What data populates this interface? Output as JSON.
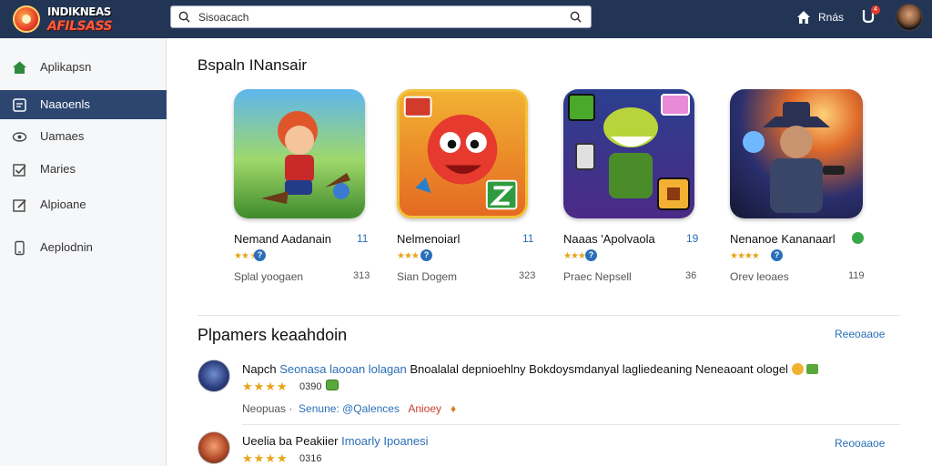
{
  "header": {
    "logo_line1": "INDIKNEAS",
    "logo_line2": "AFILSASS",
    "search_value": "Sisoacach",
    "home_label": "Rnás",
    "notif_count": "4"
  },
  "sidebar": {
    "items": [
      {
        "label": "Aplikapsn",
        "icon": "home-icon",
        "active": false
      },
      {
        "label": "Naaoenls",
        "icon": "list-icon",
        "active": true
      },
      {
        "label": "Uamaes",
        "icon": "eye-icon",
        "active": false
      },
      {
        "label": "Maries",
        "icon": "check-box-icon",
        "active": false
      },
      {
        "label": "Alpioane",
        "icon": "edit-icon",
        "active": false
      },
      {
        "label": "Aeplodnin",
        "icon": "phone-icon",
        "active": false
      }
    ]
  },
  "featured": {
    "title": "Bspaln INansair",
    "apps": [
      {
        "name": "Nemand Aadanain",
        "count": "11",
        "sub": "Splal yoogaen",
        "num": "313",
        "stars": "★★ ★"
      },
      {
        "name": "Nelmenoiarl",
        "count": "11",
        "sub": "Sian Dogem",
        "num": "323",
        "stars": "★★★"
      },
      {
        "name": "Naaas 'Apolvaola",
        "count": "19",
        "sub": "Praec Nepsell",
        "num": "36",
        "stars": "★★★"
      },
      {
        "name": "Nenanoe Kananaarl",
        "count": "",
        "sub": "Orev leoaes",
        "num": "119",
        "stars": "★★★★"
      }
    ]
  },
  "reviews": {
    "title": "Plpamers keaahdoin",
    "see_all": "Reeoaaoe",
    "items": [
      {
        "author": "Napch",
        "hl": "Seonasa laooan lolagan",
        "text": "Bnoalalal depnioehlny Bokdoysmdanyal lagliedeaning Neneaoant ologel",
        "score": "0390",
        "meta1": "Neopuas ·",
        "meta2": "Senune: @Qalences",
        "meta3": "Anioey"
      },
      {
        "author": "Ueelia ba Peakiier",
        "hl": "Imoarly Ipoanesi",
        "text": "",
        "score": "0316",
        "see_all": "Reooaaoe"
      }
    ]
  },
  "colors": {
    "header_bg": "#223555",
    "sidebar_active": "#2c4670",
    "accent_blue": "#2a6fb8",
    "star": "#e8a417"
  }
}
